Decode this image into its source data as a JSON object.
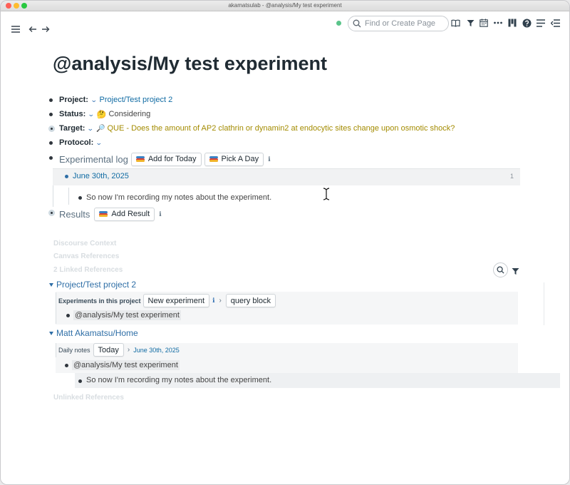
{
  "window": {
    "title": "akamatsulab - @analysis/My test experiment"
  },
  "topbar": {
    "search_placeholder": "Find or Create Page"
  },
  "page": {
    "title": "@analysis/My test experiment",
    "attributes": [
      {
        "label": "Project:",
        "value": "Project/Test project 2",
        "emoji": ""
      },
      {
        "label": "Status:",
        "value": "Considering",
        "emoji": "🤔"
      },
      {
        "label": "Target:",
        "value": "QUE - Does the amount of AP2 clathrin or dynamin2 at endocytic sites change upon osmotic shock?",
        "emoji": "🔎"
      },
      {
        "label": "Protocol:",
        "value": "",
        "emoji": ""
      }
    ],
    "experimental_log": {
      "heading": "Experimental log",
      "add_today_label": "Add for Today",
      "pick_day_label": "Pick A Day",
      "info_glyph": "ℹ",
      "date": "June 30th, 2025",
      "count": "1",
      "note": "So now I'm recording my notes about the experiment."
    },
    "results": {
      "heading": "Results",
      "add_result_label": "Add Result",
      "info_glyph": "ℹ"
    }
  },
  "references": {
    "discourse_context": "Discourse Context",
    "canvas_references": "Canvas References",
    "linked_references": "2 Linked References",
    "groups": [
      {
        "title": "Project/Test project 2",
        "label": "Experiments in this project",
        "button1": "New experiment",
        "info_glyph": "ℹ",
        "arrow": "›",
        "button2": "query block",
        "item": "@analysis/My test experiment"
      },
      {
        "title": "Matt Akamatsu/Home",
        "label": "Daily notes",
        "button1": "Today",
        "arrow": "›",
        "date": "June 30th, 2025",
        "item": "@analysis/My test experiment",
        "subitem": "So now I'm recording my notes about the experiment."
      }
    ],
    "unlinked_references": "Unlinked References"
  },
  "colors": {
    "link": "#106ba3",
    "target_text": "#a38b00",
    "status_dot": "#5ac48a"
  }
}
